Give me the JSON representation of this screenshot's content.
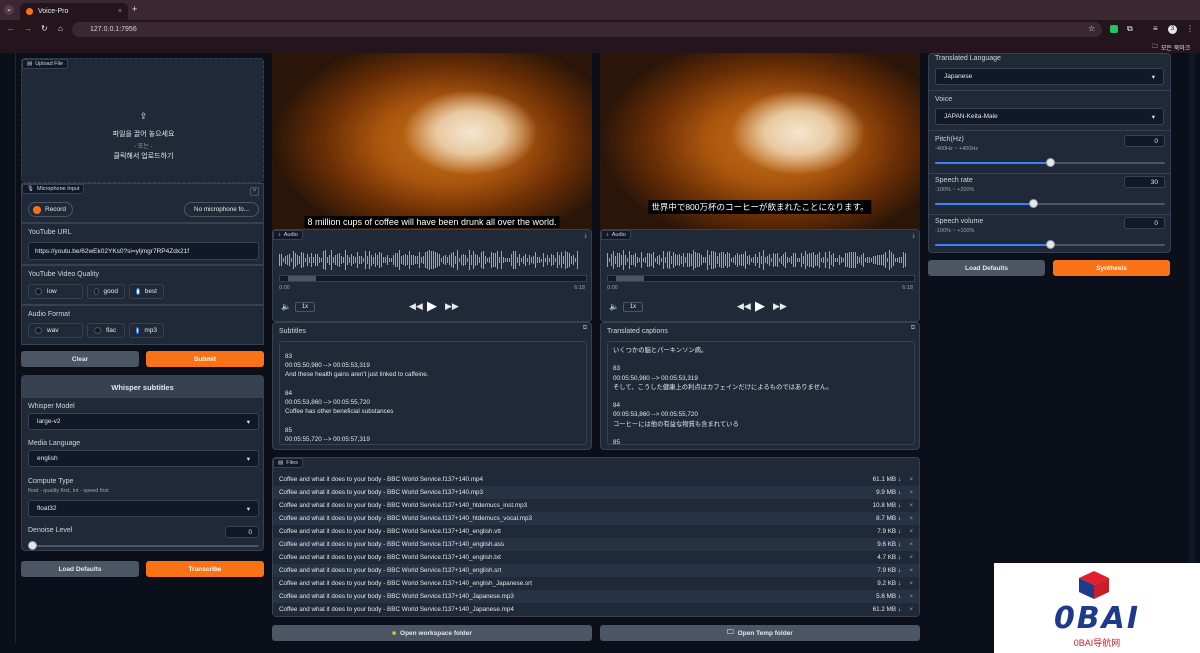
{
  "browser": {
    "tab_title": "Voice-Pro",
    "url": "127.0.0.1:7956",
    "bookmark_label": "모든 북마크",
    "profile_initial": "3"
  },
  "left": {
    "upload_tag": "Upload File",
    "upload_line1": "파일을 끌어 놓으세요",
    "upload_line2": "- 또는 -",
    "upload_line3": "클릭해서 업로드하기",
    "mic_tag": "Microphone Input",
    "record_label": "Record",
    "mic_select": "No microphone fo...",
    "youtube_url_label": "YouTube URL",
    "youtube_url_value": "https://youtu.be/62wEk02YKs0?si=yljmgr7RP4Zdx21f",
    "quality_label": "YouTube Video Quality",
    "quality_options": [
      "low",
      "good",
      "best"
    ],
    "audio_format_label": "Audio Format",
    "audio_format_options": [
      "wav",
      "flac",
      "mp3"
    ],
    "clear_label": "Clear",
    "submit_label": "Submit",
    "whisper_title": "Whisper subtitles",
    "whisper_model_label": "Whisper Model",
    "whisper_model_value": "large-v2",
    "media_language_label": "Media Language",
    "media_language_value": "english",
    "compute_type_label": "Compute Type",
    "compute_type_hint": "float - quality first, int - speed first",
    "compute_type_value": "float32",
    "denoise_label": "Denoise Level",
    "denoise_value": "0",
    "load_defaults_label": "Load Defaults",
    "transcribe_label": "Transcribe"
  },
  "middle": {
    "video_caption": "8 million cups of coffee will have been drunk all over the world.",
    "audio_tag": "Audio",
    "time_start": "0:00",
    "time_end": "6:18",
    "speed": "1x",
    "subtitles_label": "Subtitles",
    "subtitles_text": "83\n00:05:50,980 --> 00:05:53,319\nAnd these health gains aren't just linked to caffeine.\n\n84\n00:05:53,860 --> 00:05:55,720\nCoffee has other beneficial substances\n\n85\n00:05:55,720 --> 00:05:57,319",
    "files_tag": "Files",
    "files": [
      {
        "name": "Coffee and what it does to your body - BBC World Service.f137+140.mp4",
        "size": "61.1 MB ↓"
      },
      {
        "name": "Coffee and what it does to your body - BBC World Service.f137+140.mp3",
        "size": "9.9 MB ↓"
      },
      {
        "name": "Coffee and what it does to your body - BBC World Service.f137+140_htdemucs_inst.mp3",
        "size": "10.8 MB ↓"
      },
      {
        "name": "Coffee and what it does to your body - BBC World Service.f137+140_htdemucs_vocal.mp3",
        "size": "8.7 MB ↓"
      },
      {
        "name": "Coffee and what it does to your body - BBC World Service.f137+140_english.vtt",
        "size": "7.9 KB ↓"
      },
      {
        "name": "Coffee and what it does to your body - BBC World Service.f137+140_english.ass",
        "size": "9.6 KB ↓"
      },
      {
        "name": "Coffee and what it does to your body - BBC World Service.f137+140_english.txt",
        "size": "4.7 KB ↓"
      },
      {
        "name": "Coffee and what it does to your body - BBC World Service.f137+140_english.srt",
        "size": "7.9 KB ↓"
      },
      {
        "name": "Coffee and what it does to your body - BBC World Service.f137+140_english_Japanese.srt",
        "size": "9.2 KB ↓"
      },
      {
        "name": "Coffee and what it does to your body - BBC World Service.f137+140_Japanese.mp3",
        "size": "5.6 MB ↓"
      },
      {
        "name": "Coffee and what it does to your body - BBC World Service.f137+140_Japanese.mp4",
        "size": "61.2 MB ↓"
      }
    ],
    "open_workspace_label": "Open workspace folder",
    "open_temp_label": "Open Temp folder"
  },
  "right_video": {
    "video_caption": "世界中で800万杯のコーヒーが飲まれたことになります。",
    "audio_tag": "Audio",
    "time_start": "0:00",
    "time_end": "6:18",
    "speed": "1x",
    "translated_label": "Translated captions",
    "translated_text": "いくつかの脳とパーキンソン病。\n\n83\n00:05:50,980 --> 00:05:53,319\nそして、こうした健康上の利点はカフェインだけによるものではありません。\n\n84\n00:05:53,860 --> 00:05:55,720\nコーヒーには他の有益な物質も含まれている\n\n85"
  },
  "settings": {
    "translated_language_label": "Translated Language",
    "translated_language_value": "Japanese",
    "voice_label": "Voice",
    "voice_value": "JAPAN-Keita-Male",
    "pitch_label": "Pitch(Hz)",
    "pitch_range": "-400Hz ~ +400Hz",
    "pitch_value": "0",
    "pitch_fraction": 0.5,
    "rate_label": "Speech rate",
    "rate_range": "-100% ~ +200%",
    "rate_value": "30",
    "rate_fraction": 0.43,
    "volume_label": "Speech volume",
    "volume_range": "-100% ~ +100%",
    "volume_value": "0",
    "volume_fraction": 0.5,
    "load_defaults_label": "Load Defaults",
    "synthesis_label": "Synthesis"
  },
  "watermark": {
    "big": "0BAI",
    "small": "0BAI导航网"
  }
}
